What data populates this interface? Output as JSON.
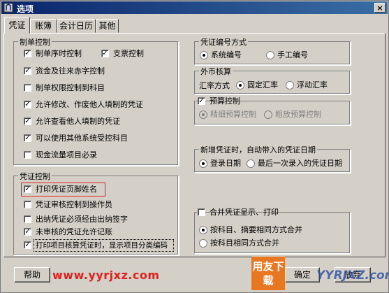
{
  "window": {
    "title": "选项",
    "close_glyph": "×"
  },
  "tabs": [
    "凭证",
    "账簿",
    "会计日历",
    "其他"
  ],
  "make_control": {
    "title": "制单控制",
    "items": [
      {
        "label": "制单序时控制",
        "checked": true
      },
      {
        "label": "支票控制",
        "checked": true
      },
      {
        "label": "资金及往来赤字控制",
        "checked": true
      },
      {
        "label": "制单权限控制到科目",
        "checked": false
      },
      {
        "label": "允许修改、作废他人填制的凭证",
        "checked": true
      },
      {
        "label": "允许查看他人填制的凭证",
        "checked": true
      },
      {
        "label": "可以使用其他系统受控科目",
        "checked": true
      },
      {
        "label": "现金流量项目必录",
        "checked": false
      }
    ]
  },
  "voucher_control": {
    "title": "凭证控制",
    "items": [
      {
        "label": "打印凭证页脚姓名",
        "checked": true
      },
      {
        "label": "凭证审核控制到操作员",
        "checked": false
      },
      {
        "label": "出纳凭证必须经由出纳签字",
        "checked": false
      },
      {
        "label": "未审核的凭证允许记账",
        "checked": true
      },
      {
        "label": "打印项目核算凭证时，显示项目分类编码",
        "checked": true
      }
    ]
  },
  "numbering": {
    "title": "凭证编号方式",
    "options": [
      "系统编号",
      "手工编号"
    ],
    "selected": 0
  },
  "forex": {
    "title": "外币核算",
    "rate_label": "汇率方式",
    "options": [
      "固定汇率",
      "浮动汇率"
    ],
    "selected": 0
  },
  "budget": {
    "label": "预算控制",
    "checked": true,
    "options": [
      "精细预算控制",
      "粗放预算控制"
    ],
    "selected": 0
  },
  "new_voucher_date": {
    "title": "新增凭证时，自动带入的凭证日期",
    "options": [
      "登录日期",
      "最后一次录入的凭证日期"
    ],
    "selected": 0
  },
  "merge": {
    "label": "合并凭证显示、打印",
    "checked": false,
    "options": [
      "按科目、摘要相同方式合并",
      "按科目相同方式合并"
    ],
    "selected": 0
  },
  "buttons": {
    "help": "帮助",
    "ok": "确定",
    "cancel": "放弃"
  },
  "watermark": {
    "url": "www.yyrjxz.com",
    "logo": "用友下载",
    "site": "YYRJXZ.com"
  },
  "colors": {
    "title_bar": "#0a246a",
    "face": "#d4d0c8",
    "highlight_box": "#e02020",
    "watermark_red": "#e0201e"
  }
}
